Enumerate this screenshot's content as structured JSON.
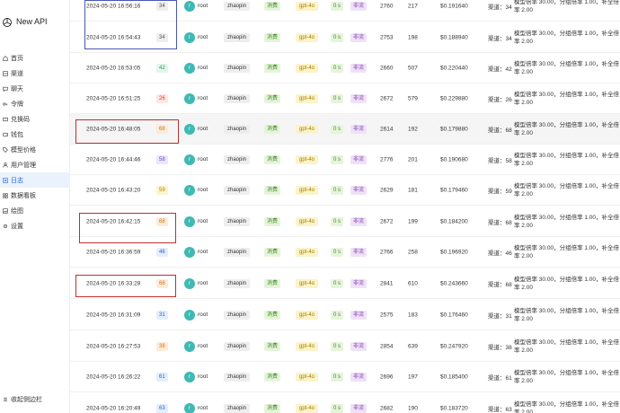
{
  "app": {
    "title": "New API",
    "accent": "#1b63d6"
  },
  "sidebar": {
    "items": [
      {
        "label": "首页",
        "icon": "home-icon",
        "active": false
      },
      {
        "label": "渠道",
        "icon": "channel-icon",
        "active": false
      },
      {
        "label": "聊天",
        "icon": "chat-icon",
        "active": false
      },
      {
        "label": "令牌",
        "icon": "key-icon",
        "active": false
      },
      {
        "label": "兑换码",
        "icon": "ticket-icon",
        "active": false
      },
      {
        "label": "钱包",
        "icon": "wallet-icon",
        "active": false
      },
      {
        "label": "模型价格",
        "icon": "tag-icon",
        "active": false
      },
      {
        "label": "用户管理",
        "icon": "user-icon",
        "active": false
      },
      {
        "label": "日志",
        "icon": "log-icon",
        "active": true
      },
      {
        "label": "数据看板",
        "icon": "dashboard-icon",
        "active": false
      },
      {
        "label": "绘图",
        "icon": "image-icon",
        "active": false
      },
      {
        "label": "设置",
        "icon": "gear-icon",
        "active": false
      }
    ],
    "collapse_label": "收起侧边栏"
  },
  "rows": [
    {
      "time": "2024-05-20 16:56:16",
      "channel": "34",
      "channel_color": "gray",
      "user": "root",
      "user_initial": "r",
      "token": "zhaopin",
      "type": "消费",
      "model": "gpt-4o",
      "duration": "0 s",
      "stream": "非流",
      "prompt": "2760",
      "completion": "217",
      "cost": "$0.191640",
      "detail_channel": "渠道：34",
      "detail": "模型倍率 30.00，分组倍率 1.00，补全倍率 2.00",
      "highlight": false
    },
    {
      "time": "2024-05-20 16:54:43",
      "channel": "34",
      "channel_color": "gray",
      "user": "root",
      "user_initial": "r",
      "token": "zhaopin",
      "type": "消费",
      "model": "gpt-4o",
      "duration": "0 s",
      "stream": "非流",
      "prompt": "2753",
      "completion": "198",
      "cost": "$0.188940",
      "detail_channel": "渠道：34",
      "detail": "模型倍率 30.00，分组倍率 1.00，补全倍率 2.00",
      "highlight": false
    },
    {
      "time": "2024-05-20 16:53:05",
      "channel": "42",
      "channel_color": "green",
      "user": "root",
      "user_initial": "r",
      "token": "zhaopin",
      "type": "消费",
      "model": "gpt-4o",
      "duration": "0 s",
      "stream": "非流",
      "prompt": "2660",
      "completion": "507",
      "cost": "$0.220440",
      "detail_channel": "渠道：42",
      "detail": "模型倍率 30.00，分组倍率 1.00，补全倍率 2.00",
      "highlight": false
    },
    {
      "time": "2024-05-20 16:51:25",
      "channel": "26",
      "channel_color": "red",
      "user": "root",
      "user_initial": "r",
      "token": "zhaopin",
      "type": "消费",
      "model": "gpt-4o",
      "duration": "0 s",
      "stream": "非流",
      "prompt": "2672",
      "completion": "579",
      "cost": "$0.229880",
      "detail_channel": "渠道：26",
      "detail": "模型倍率 30.00，分组倍率 1.00，补全倍率 2.00",
      "highlight": false
    },
    {
      "time": "2024-05-20 16:48:05",
      "channel": "68",
      "channel_color": "orange",
      "user": "root",
      "user_initial": "r",
      "token": "zhaopin",
      "type": "消费",
      "model": "gpt-4o",
      "duration": "0 s",
      "stream": "非流",
      "prompt": "2614",
      "completion": "192",
      "cost": "$0.179880",
      "detail_channel": "渠道：68",
      "detail": "模型倍率 30.00，分组倍率 1.00，补全倍率 2.00",
      "highlight": true
    },
    {
      "time": "2024-05-20 16:44:46",
      "channel": "58",
      "channel_color": "purple",
      "user": "root",
      "user_initial": "r",
      "token": "zhaopin",
      "type": "消费",
      "model": "gpt-4o",
      "duration": "0 s",
      "stream": "非流",
      "prompt": "2776",
      "completion": "201",
      "cost": "$0.190680",
      "detail_channel": "渠道：58",
      "detail": "模型倍率 30.00，分组倍率 1.00，补全倍率 2.00",
      "highlight": false
    },
    {
      "time": "2024-05-20 16:43:20",
      "channel": "59",
      "channel_color": "yellow",
      "user": "root",
      "user_initial": "r",
      "token": "zhaopin",
      "type": "消费",
      "model": "gpt-4o",
      "duration": "0 s",
      "stream": "非流",
      "prompt": "2629",
      "completion": "181",
      "cost": "$0.179460",
      "detail_channel": "渠道：59",
      "detail": "模型倍率 30.00，分组倍率 1.00，补全倍率 2.00",
      "highlight": false
    },
    {
      "time": "2024-05-20 16:42:15",
      "channel": "68",
      "channel_color": "orange",
      "user": "root",
      "user_initial": "r",
      "token": "zhaopin",
      "type": "消费",
      "model": "gpt-4o",
      "duration": "0 s",
      "stream": "非流",
      "prompt": "2672",
      "completion": "199",
      "cost": "$0.184200",
      "detail_channel": "渠道：68",
      "detail": "模型倍率 30.00，分组倍率 1.00，补全倍率 2.00",
      "highlight": false
    },
    {
      "time": "2024-05-20 16:36:59",
      "channel": "46",
      "channel_color": "blue",
      "user": "root",
      "user_initial": "r",
      "token": "zhaopin",
      "type": "消费",
      "model": "gpt-4o",
      "duration": "0 s",
      "stream": "非流",
      "prompt": "2766",
      "completion": "258",
      "cost": "$0.196920",
      "detail_channel": "渠道：46",
      "detail": "模型倍率 30.00，分组倍率 1.00，补全倍率 2.00",
      "highlight": false
    },
    {
      "time": "2024-05-20 16:33:28",
      "channel": "68",
      "channel_color": "orange",
      "user": "root",
      "user_initial": "r",
      "token": "zhaopin",
      "type": "消费",
      "model": "gpt-4o",
      "duration": "0 s",
      "stream": "非流",
      "prompt": "2841",
      "completion": "610",
      "cost": "$0.243660",
      "detail_channel": "渠道：68",
      "detail": "模型倍率 30.00，分组倍率 1.00，补全倍率 2.00",
      "highlight": false
    },
    {
      "time": "2024-05-20 16:31:09",
      "channel": "31",
      "channel_color": "blue",
      "user": "root",
      "user_initial": "r",
      "token": "zhaopin",
      "type": "消费",
      "model": "gpt-4o",
      "duration": "0 s",
      "stream": "非流",
      "prompt": "2575",
      "completion": "183",
      "cost": "$0.176460",
      "detail_channel": "渠道：31",
      "detail": "模型倍率 30.00，分组倍率 1.00，补全倍率 2.00",
      "highlight": false
    },
    {
      "time": "2024-05-20 16:27:53",
      "channel": "38",
      "channel_color": "orange",
      "user": "root",
      "user_initial": "r",
      "token": "zhaopin",
      "type": "消费",
      "model": "gpt-4o",
      "duration": "0 s",
      "stream": "非流",
      "prompt": "2854",
      "completion": "639",
      "cost": "$0.247920",
      "detail_channel": "渠道：38",
      "detail": "模型倍率 30.00，分组倍率 1.00，补全倍率 2.00",
      "highlight": false
    },
    {
      "time": "2024-05-20 16:26:22",
      "channel": "61",
      "channel_color": "blue",
      "user": "root",
      "user_initial": "r",
      "token": "zhaopin",
      "type": "消费",
      "model": "gpt-4o",
      "duration": "0 s",
      "stream": "非流",
      "prompt": "2696",
      "completion": "197",
      "cost": "$0.185400",
      "detail_channel": "渠道：61",
      "detail": "模型倍率 30.00，分组倍率 1.00，补全倍率 2.00",
      "highlight": false
    },
    {
      "time": "2024-05-20 16:20:49",
      "channel": "63",
      "channel_color": "blue",
      "user": "root",
      "user_initial": "r",
      "token": "zhaopin",
      "type": "消费",
      "model": "gpt-4o",
      "duration": "0 s",
      "stream": "非流",
      "prompt": "2682",
      "completion": "190",
      "cost": "$0.183720",
      "detail_channel": "渠道：63",
      "detail": "模型倍率 30.00，分组倍率 1.00，补全倍率 2.00",
      "highlight": false
    }
  ],
  "annotation_colors": {
    "blue": "#4a57b5",
    "red": "#b8312f"
  }
}
